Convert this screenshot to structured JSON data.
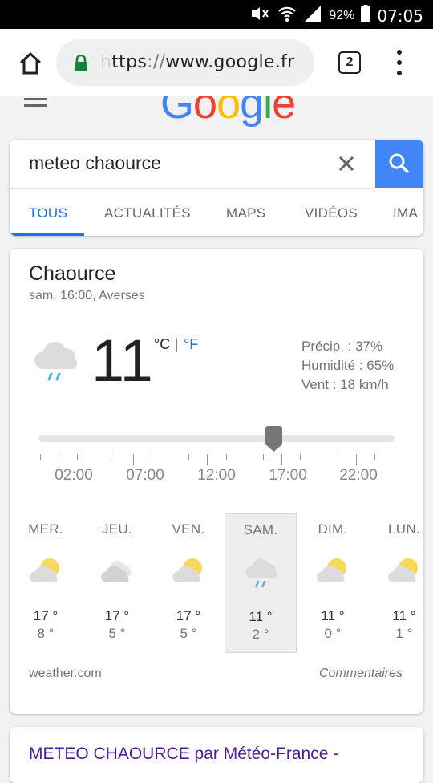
{
  "status": {
    "time": "07:05",
    "battery": "92%"
  },
  "browser": {
    "url_faded": "h",
    "url_scheme": "ttps",
    "url_sep": "://",
    "url_host": "www.google.fr",
    "tab_count": "2"
  },
  "search": {
    "query": "meteo chaource",
    "tabs": [
      "TOUS",
      "ACTUALITÉS",
      "MAPS",
      "VIDÉOS",
      "IMA"
    ],
    "active_tab": "TOUS"
  },
  "weather": {
    "location": "Chaource",
    "subtitle": "sam. 16:00, Averses",
    "temp": "11",
    "unit_c": "°C",
    "unit_sep": "|",
    "unit_f": "°F",
    "precip": "Précip. : 37%",
    "humidity": "Humidité : 65%",
    "wind": "Vent : 18 km/h",
    "time_labels": [
      "02:00",
      "07:00",
      "12:00",
      "17:00",
      "22:00"
    ],
    "slider_position": 0.66,
    "days": [
      {
        "name": "MER.",
        "hi": "17 °",
        "lo": "8 °",
        "icon": "partly-sunny-icon"
      },
      {
        "name": "JEU.",
        "hi": "17 °",
        "lo": "5 °",
        "icon": "cloudy-icon"
      },
      {
        "name": "VEN.",
        "hi": "17 °",
        "lo": "5 °",
        "icon": "partly-sunny-icon"
      },
      {
        "name": "SAM.",
        "hi": "11 °",
        "lo": "2 °",
        "icon": "showers-icon",
        "selected": true
      },
      {
        "name": "DIM.",
        "hi": "11 °",
        "lo": "0 °",
        "icon": "partly-sunny-icon"
      },
      {
        "name": "LUN.",
        "hi": "11 °",
        "lo": "1 °",
        "icon": "partly-sunny-icon"
      }
    ],
    "source": "weather.com",
    "comments": "Commentaires"
  },
  "result": {
    "title": "METEO CHAOURCE par Météo-France -"
  },
  "colors": {
    "accent": "#1a73e8",
    "search_button": "#4285f4",
    "visited_link": "#4b1b9c",
    "sun": "#f7d85a",
    "cloud": "#dcdcdc",
    "rain": "#4fb6d6"
  }
}
